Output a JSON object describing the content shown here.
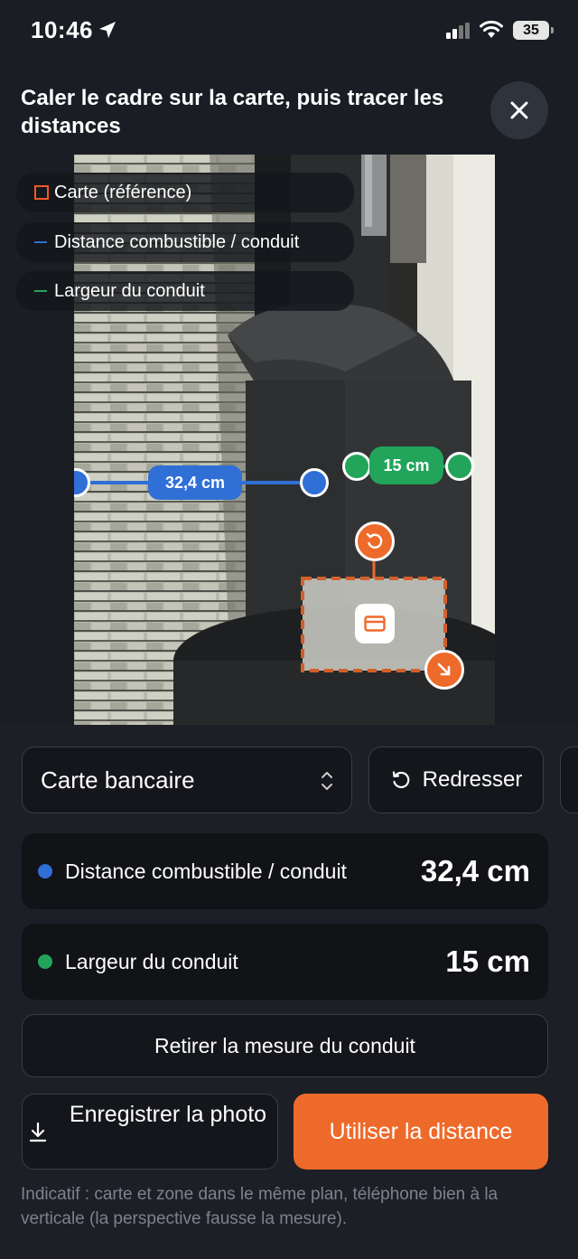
{
  "status_bar": {
    "time": "10:46",
    "battery": "35"
  },
  "header": {
    "instruction": "Caler le cadre sur la carte, puis tracer les distances"
  },
  "legend": [
    {
      "label": "Carte (référence)",
      "color": "#ef5a23"
    },
    {
      "label": "Distance combustible / conduit",
      "color": "#2f6fd6"
    },
    {
      "label": "Largeur du conduit",
      "color": "#22a55b"
    }
  ],
  "overlay": {
    "distance_label": "32,4 cm",
    "width_label": "15 cm"
  },
  "controls": {
    "card_type": "Carte bancaire",
    "straighten_label": "Redresser"
  },
  "measurements": [
    {
      "label": "Distance combustible / conduit",
      "value": "32,4 cm",
      "color": "#2f6fd6"
    },
    {
      "label": "Largeur du conduit",
      "value": "15 cm",
      "color": "#22a55b"
    }
  ],
  "actions": {
    "remove_label": "Retirer la mesure du conduit",
    "save_label": "Enregistrer la photo",
    "use_label": "Utiliser la distance"
  },
  "note": "Indicatif : carte et zone dans le même plan, téléphone bien à la verticale (la perspective fausse la mesure)."
}
